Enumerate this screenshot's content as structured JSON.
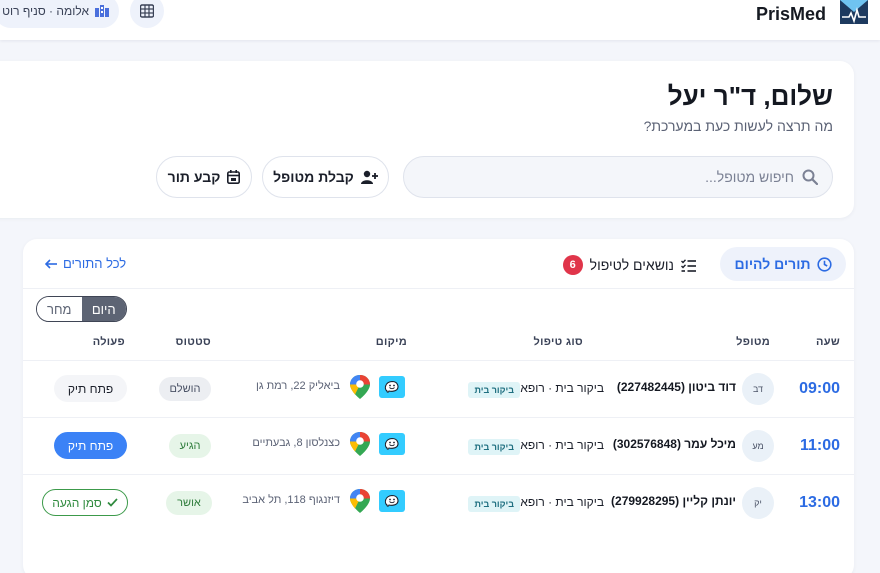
{
  "topbar": {
    "brand": "PrisMed",
    "branch": "אלומה · סניף רוט"
  },
  "greeting": {
    "title": "שלום, ד\"ר יעל",
    "subtitle": "מה תרצה לעשות כעת במערכת?",
    "search_placeholder": "חיפוש מטופל...",
    "intake_label": "קבלת מטופל",
    "schedule_label": "קבע תור"
  },
  "schedule": {
    "tab_today": "תורים להיום",
    "tab_issues": "נושאים לטיפול",
    "issues_count": "6",
    "all_link": "לכל התורים",
    "day_today": "היום",
    "day_tomorrow": "מחר",
    "columns": {
      "time": "שעה",
      "patient": "מטופל",
      "type": "סוג טיפול",
      "location": "מיקום",
      "status": "סטטוס",
      "action": "פעולה"
    },
    "rows": [
      {
        "time": "09:00",
        "initials": "דב",
        "patient": "דוד ביטון (227482445)",
        "type": "ביקור בית · רופא",
        "tag": "ביקור בית",
        "address": "ביאליק 22, רמת גן",
        "status": "הושלם",
        "action": "פתח תיק"
      },
      {
        "time": "11:00",
        "initials": "מע",
        "patient": "מיכל עמר (302576848)",
        "type": "ביקור בית · רופא",
        "tag": "ביקור בית",
        "address": "כצנלסון 8, גבעתיים",
        "status": "הגיע",
        "action": "פתח תיק"
      },
      {
        "time": "13:00",
        "initials": "יק",
        "patient": "יונתן קליין (279928295)",
        "type": "ביקור בית · רופא",
        "tag": "ביקור בית",
        "address": "דיזנגוף 118, תל אביב",
        "status": "אושר",
        "action": "סמן הגעה"
      }
    ]
  },
  "colors": {
    "accent": "#2c6be3",
    "danger": "#e0354a",
    "success": "#2f8a3e",
    "waze": "#33ccff"
  }
}
